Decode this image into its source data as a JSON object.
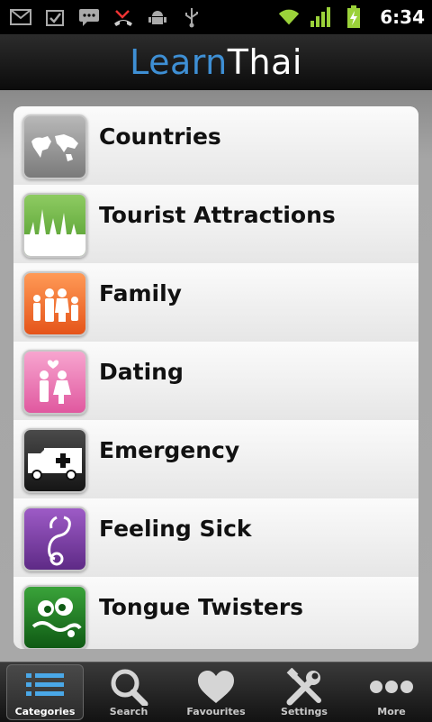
{
  "status_bar": {
    "time": "6:34",
    "left_icons": [
      "gmail-icon",
      "task-icon",
      "sms-icon",
      "missed-call-icon",
      "android-debug-icon",
      "usb-icon"
    ],
    "right_icons": [
      "wifi-icon",
      "signal-icon",
      "battery-charging-icon"
    ]
  },
  "header": {
    "logo_part1": "Learn",
    "logo_part2": "Thai",
    "colors": {
      "learn": "#3e8fd4",
      "thai": "#ffffff"
    }
  },
  "categories": [
    {
      "label": "Countries",
      "icon": "world-map-icon",
      "color": "#8a8a8a"
    },
    {
      "label": "Tourist Attractions",
      "icon": "temple-icon",
      "color": "#5faa35"
    },
    {
      "label": "Family",
      "icon": "family-icon",
      "color": "#f06a28"
    },
    {
      "label": "Dating",
      "icon": "couple-icon",
      "color": "#e8679f"
    },
    {
      "label": "Emergency",
      "icon": "ambulance-icon",
      "color": "#2a2a2a"
    },
    {
      "label": "Feeling Sick",
      "icon": "stethoscope-icon",
      "color": "#6e3596"
    },
    {
      "label": "Tongue Twisters",
      "icon": "tongue-face-icon",
      "color": "#1d7a1e"
    }
  ],
  "tabs": [
    {
      "label": "Categories",
      "icon": "list-icon",
      "active": true
    },
    {
      "label": "Search",
      "icon": "magnifier-icon",
      "active": false
    },
    {
      "label": "Favourites",
      "icon": "heart-icon",
      "active": false
    },
    {
      "label": "Settings",
      "icon": "tools-icon",
      "active": false
    },
    {
      "label": "More",
      "icon": "more-dots-icon",
      "active": false
    }
  ]
}
